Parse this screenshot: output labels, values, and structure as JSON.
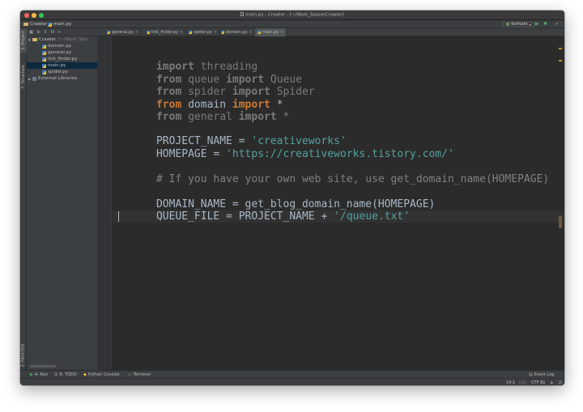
{
  "window": {
    "title": "main.py - Crawler - [~/Work_Space/Crawler]"
  },
  "navbar": {
    "project": "Crawler",
    "file": "main.py",
    "run_config": "domain"
  },
  "left_strip": {
    "project_tab": "1: Project",
    "structure_tab": "7: Structure",
    "favorites_tab": "2: Favorites"
  },
  "project_panel": {
    "root": {
      "name": "Crawler",
      "path": "(~/Work_Spa"
    },
    "files": [
      "domain.py",
      "general.py",
      "link_finder.py",
      "main.py",
      "spider.py"
    ],
    "selected_file": "main.py",
    "external": "External Libraries"
  },
  "tabs": [
    {
      "label": "general.py",
      "active": false
    },
    {
      "label": "link_finder.py",
      "active": false
    },
    {
      "label": "spider.py",
      "active": false
    },
    {
      "label": "domain.py",
      "active": false
    },
    {
      "label": "main.py",
      "active": true
    }
  ],
  "editor": {
    "l1": {
      "kw": "import",
      "rest": " threading"
    },
    "l2": {
      "kw1": "from",
      "mid": " queue ",
      "kw2": "import",
      "rest": " Queue"
    },
    "l3": {
      "kw1": "from",
      "mid": " spider ",
      "kw2": "import",
      "rest": " Spider"
    },
    "l4": {
      "kw1": "from",
      "mid": " domain ",
      "kw2": "import",
      "rest": " *"
    },
    "l5": {
      "kw1": "from",
      "mid": " general ",
      "kw2": "import",
      "rest": " *"
    },
    "l7": {
      "lhs": "PROJECT_NAME = ",
      "str": "'creativeworks'"
    },
    "l8": {
      "lhs": "HOMEPAGE = ",
      "str": "'https://creativeworks.tistory.com/'"
    },
    "l10": {
      "comment": "# If you have your own web site, use get_domain_name(HOMEPAGE)"
    },
    "l12": {
      "code": "DOMAIN_NAME = get_blog_domain_name(HOMEPAGE)"
    },
    "l13": {
      "lhs": "QUEUE_FILE = PROJECT_NAME + ",
      "str": "'/queue.txt'"
    }
  },
  "bottom_tools": {
    "run": "4: Run",
    "todo": "6: TODO",
    "python_console": "Python Console",
    "terminal": "Terminal",
    "event_log": "Event Log"
  },
  "status": {
    "position": "14:1",
    "line_sep": "n/a",
    "encoding": "UTF-8‡"
  },
  "colors": {
    "editor_bg": "#2b2b2b",
    "keyword": "#cc7832",
    "string": "#57a0a0",
    "comment": "#808080",
    "panel_bg": "#3c3f41",
    "selection": "#0d293e"
  }
}
